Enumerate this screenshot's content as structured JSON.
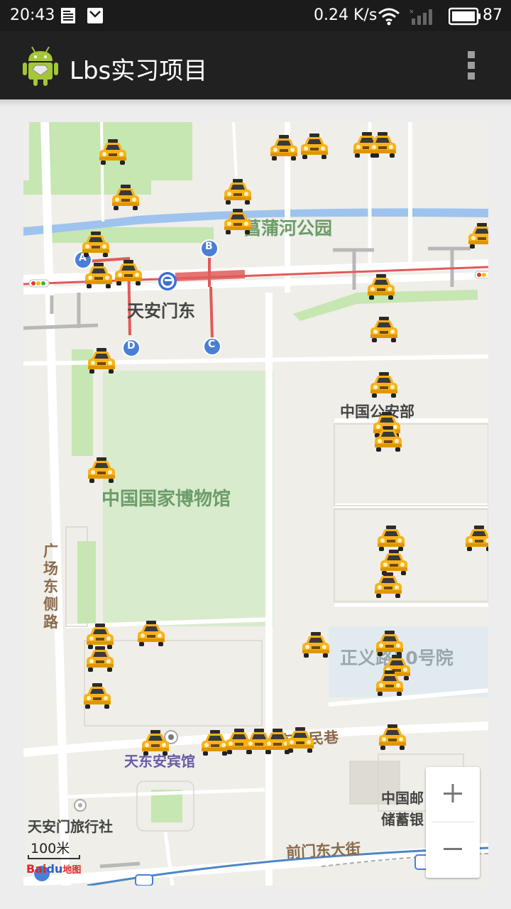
{
  "status_bar": {
    "time": "20:43",
    "network_speed": "0.24 K/s",
    "battery": "87",
    "icons": [
      "notes-icon",
      "mail-icon",
      "wifi-icon",
      "signal-icon",
      "battery-icon"
    ]
  },
  "action_bar": {
    "title": "Lbs实习项目",
    "logo_icon": "android-icon",
    "overflow_icon": "more-vert-icon"
  },
  "map": {
    "labels": {
      "park": "菖蒲河公园",
      "station": "天安门东",
      "ministry": "中国公安部",
      "museum": "中国国家博物馆",
      "east_side_road": "广场东侧路",
      "courtyard": "正义路10号院",
      "hotel": "天东安宾馆",
      "alley": "东交民巷",
      "travel_agency": "天安门旅行社",
      "bank": "中国邮政储蓄银行",
      "bank_line1": "中国邮",
      "bank_line2": "储蓄银",
      "street": "前门东大街"
    },
    "subway_exits": [
      "A",
      "B",
      "C",
      "D"
    ],
    "scale_label": "100米",
    "logo_text": "Baidu地图",
    "logo_part1": "Bai",
    "logo_part2": "du",
    "logo_part3": "地图",
    "taxi_icon": "taxi-icon",
    "taxi_marker_count": 40,
    "accent_colors": {
      "subway_line": "#e05a5a",
      "water": "#9ec3ef",
      "park": "#c6e6b2",
      "exit_badge": "#4a7fd6",
      "taxi": "#f8b21a"
    }
  },
  "zoom_controls": {
    "zoom_in": "+",
    "zoom_out": "−"
  }
}
